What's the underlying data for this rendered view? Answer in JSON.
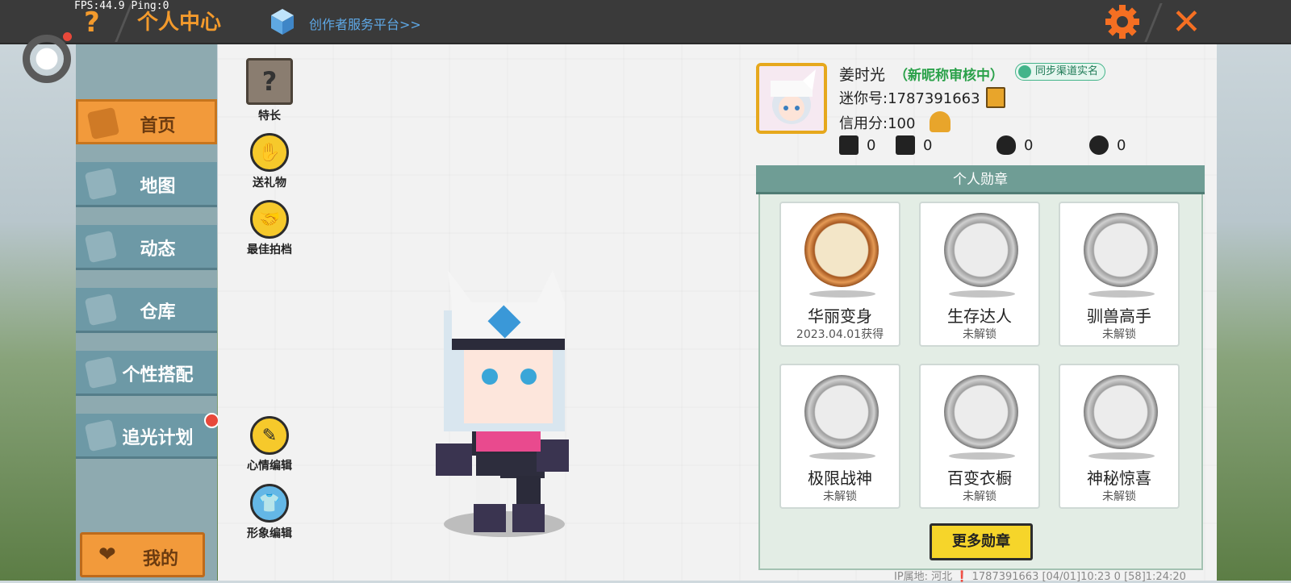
{
  "status": {
    "fps": "FPS:44.9  Ping:0"
  },
  "header": {
    "help_icon": "?",
    "title": "个人中心",
    "creator_link": "创作者服务平台>>",
    "close_icon": "✕",
    "colors": {
      "accent": "#f39a2c",
      "link": "#5ea8e6",
      "bar": "#3a3a3a"
    }
  },
  "sidebar": {
    "items": [
      {
        "label": "首页",
        "icon": "house-icon",
        "active": true
      },
      {
        "label": "地图",
        "icon": "picture-icon",
        "active": false
      },
      {
        "label": "动态",
        "icon": "bell-icon",
        "active": false
      },
      {
        "label": "仓库",
        "icon": "warehouse-icon",
        "active": false
      },
      {
        "label": "个性搭配",
        "icon": "outfit-icon",
        "active": false
      },
      {
        "label": "追光计划",
        "icon": "notebook-icon",
        "active": false
      }
    ],
    "mine_label": "我的"
  },
  "actions": {
    "specialty": "特长",
    "specialty_icon": "?",
    "gift": "送礼物",
    "partner": "最佳拍档",
    "mood_edit": "心情编辑",
    "image_edit": "形象编辑"
  },
  "profile": {
    "name": "姜时光",
    "nickname_status": "（新昵称审核中）",
    "sync_badge": "同步渠道实名",
    "mini_id": "迷你号:1787391663",
    "credit": "信用分:100",
    "stats": [
      {
        "icon": "bookmark-plus-icon",
        "value": "0"
      },
      {
        "icon": "fans-icon",
        "value": "0"
      },
      {
        "icon": "flame-icon",
        "value": "0"
      },
      {
        "icon": "hearts-icon",
        "value": "0"
      }
    ]
  },
  "badges": {
    "header": "个人勋章",
    "items": [
      {
        "name": "华丽变身",
        "sub": "2023.04.01获得",
        "unlocked": true
      },
      {
        "name": "生存达人",
        "sub": "未解锁",
        "unlocked": false
      },
      {
        "name": "驯兽高手",
        "sub": "未解锁",
        "unlocked": false
      },
      {
        "name": "极限战神",
        "sub": "未解锁",
        "unlocked": false
      },
      {
        "name": "百变衣橱",
        "sub": "未解锁",
        "unlocked": false
      },
      {
        "name": "神秘惊喜",
        "sub": "未解锁",
        "unlocked": false
      }
    ],
    "more_button": "更多勋章"
  },
  "footer": {
    "text": "IP属地: 河北 ❗  1787391663  [04/01]10:23 0  [58]1:24:20"
  }
}
